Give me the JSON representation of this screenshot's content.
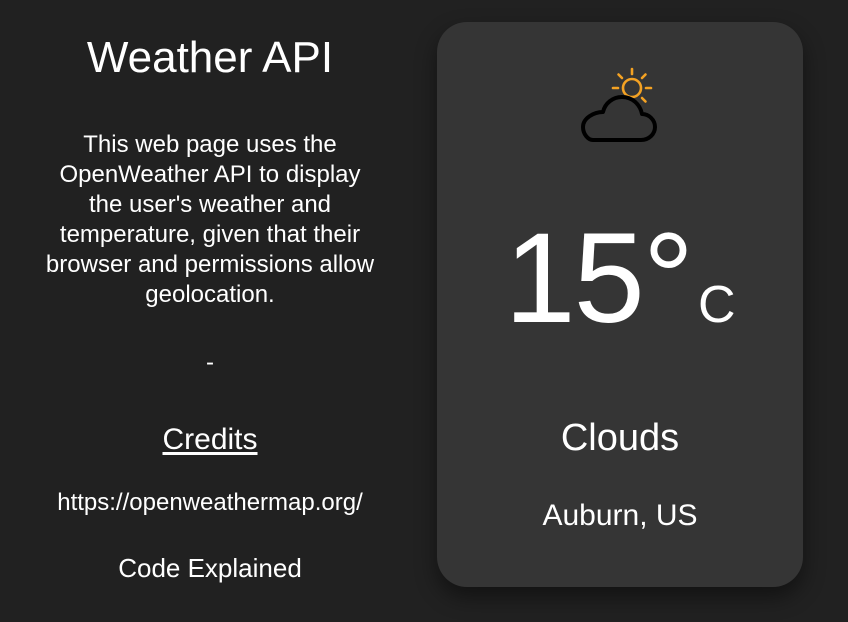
{
  "left": {
    "title": "Weather API",
    "description": "This web page uses the OpenWeather API to display the user's weather and temperature, given that their browser and permissions allow geolocation.",
    "separator": "-",
    "credits_heading": "Credits",
    "credit_link": "https://openweathermap.org/",
    "credit_code": "Code Explained"
  },
  "card": {
    "icon": "partly-cloudy-icon",
    "temperature": "15°",
    "unit": "C",
    "condition": "Clouds",
    "location": "Auburn, US"
  },
  "colors": {
    "background": "#212121",
    "card": "#353535",
    "sun": "#f4a223",
    "text": "#ffffff"
  }
}
